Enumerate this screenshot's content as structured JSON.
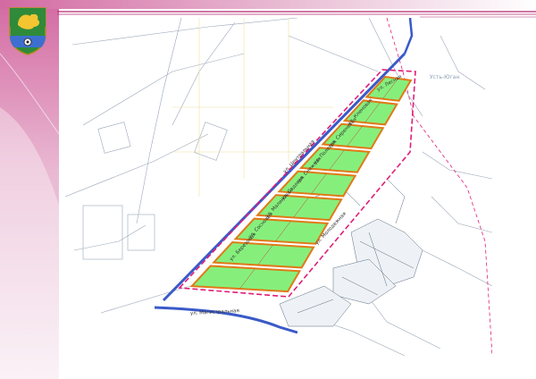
{
  "slide": {
    "colors": {
      "band_pink": "#e6b3ce",
      "band_magenta": "#b5266e",
      "background": "#ffffff"
    }
  },
  "emblem": {
    "icon": "coat-of-arms-icon"
  },
  "map": {
    "colors": {
      "plot_fill": "#86ef7c",
      "plot_border": "#e07a18",
      "plot_inner": "#c0463a",
      "boundary_dashed": "#e01e78",
      "road": "#3a5ac8",
      "base_lines": "#9aa6b8"
    },
    "streets": [
      "ул. Центральная",
      "ул. Кленовая",
      "ул. Сиреневая",
      "ул. Полевая",
      "ул. Снежная",
      "ул. Садовая",
      "ул. Малиновая",
      "ул. Сосновая",
      "ул. Березовая",
      "ул. Магистральная",
      "ул. Молодежная",
      "ул. Лесная"
    ],
    "place_names": [
      "Усть-Юган"
    ]
  }
}
